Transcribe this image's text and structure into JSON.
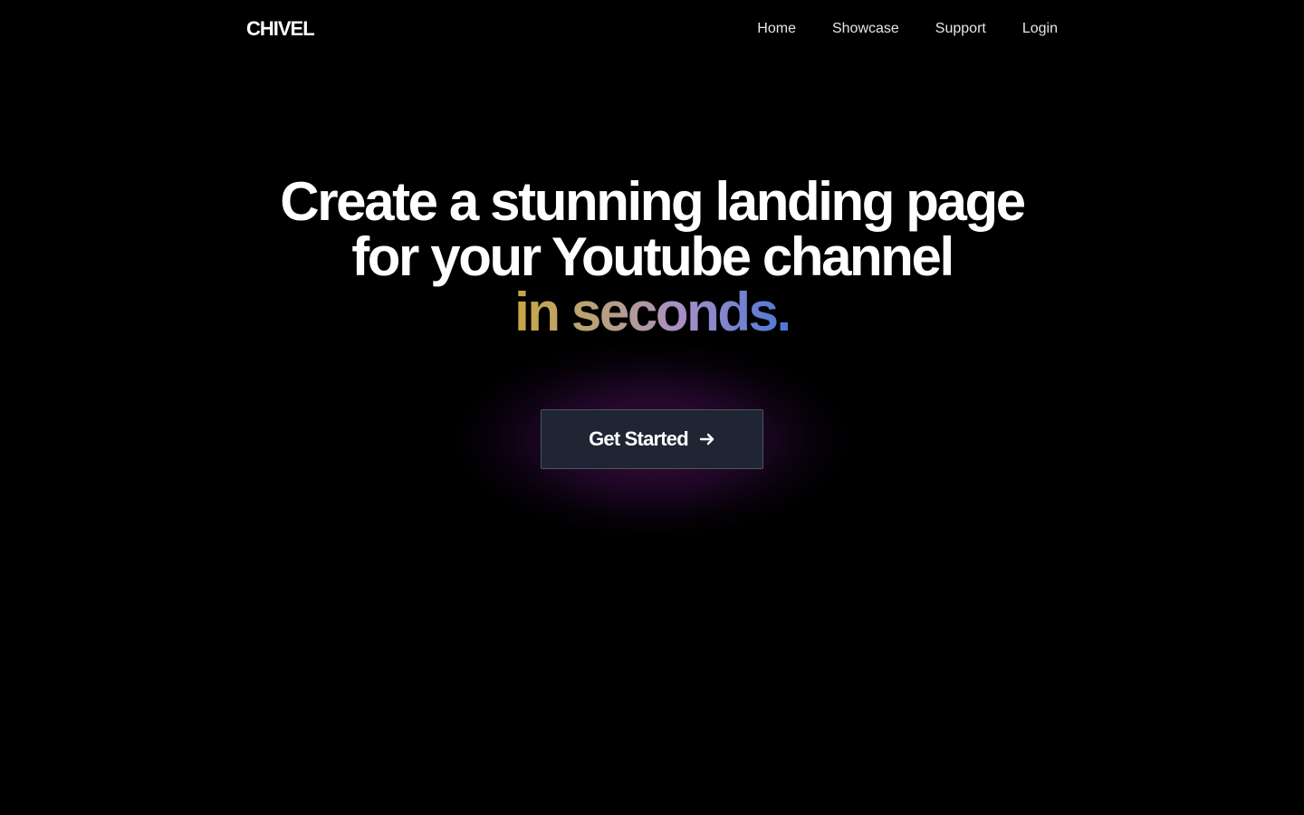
{
  "nav": {
    "logo": "CHIVEL",
    "links": [
      "Home",
      "Showcase",
      "Support",
      "Login"
    ]
  },
  "hero": {
    "line1": "Create a stunning landing page",
    "line2": "for your Youtube channel",
    "line3": "in seconds."
  },
  "cta": {
    "label": "Get Started",
    "icon": "arrow-right-icon"
  },
  "colors": {
    "background": "#000000",
    "button_bg": "#1f2533",
    "gradient": [
      "#c9a645",
      "#b8a27a",
      "#a98fc4",
      "#4a78d8"
    ],
    "glow": "#78145a"
  }
}
